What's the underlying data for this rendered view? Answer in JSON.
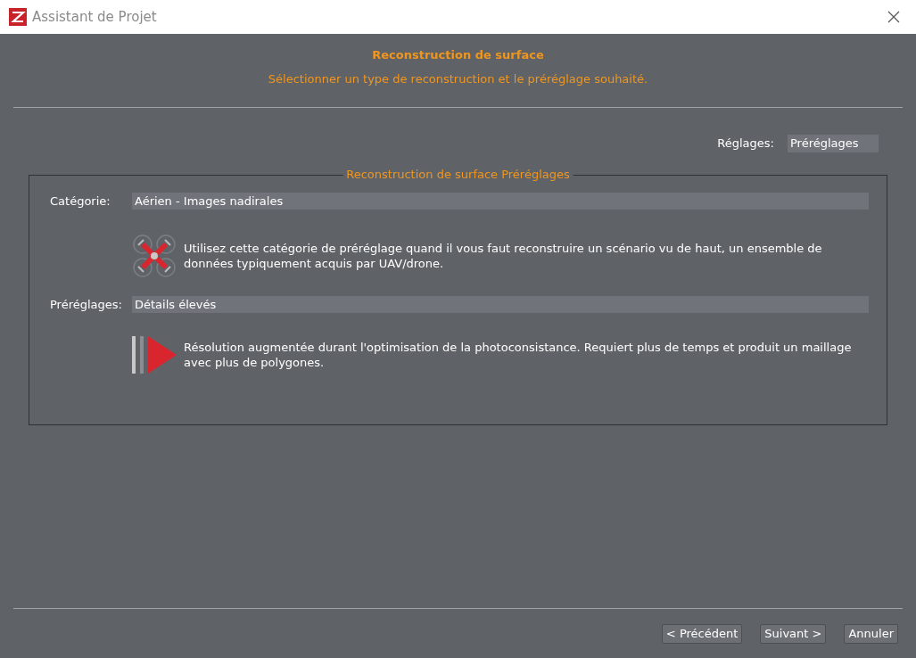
{
  "window": {
    "title": "Assistant de Projet"
  },
  "header": {
    "title": "Reconstruction de surface",
    "subtitle": "Sélectionner un type de reconstruction et le préréglage souhaité."
  },
  "settings": {
    "label": "Réglages:",
    "value": "Préréglages"
  },
  "group": {
    "title": "Reconstruction de surface Préréglages",
    "fields": [
      {
        "kind": "drone",
        "label": "Catégorie:",
        "value": "Aérien - Images nadirales",
        "description": "Utilisez cette catégorie de préréglage quand il vous faut reconstruire un scénario vu de haut, un ensemble de données typiquement acquis par UAV/drone."
      },
      {
        "kind": "quality",
        "label": "Préréglages:",
        "value": "Détails élevés",
        "description": "Résolution augmentée durant l'optimisation de la photoconsistance. Requiert plus de temps et produit un maillage avec plus de polygones."
      }
    ]
  },
  "buttons": [
    "< Précédent",
    "Suivant >",
    "Annuler"
  ]
}
